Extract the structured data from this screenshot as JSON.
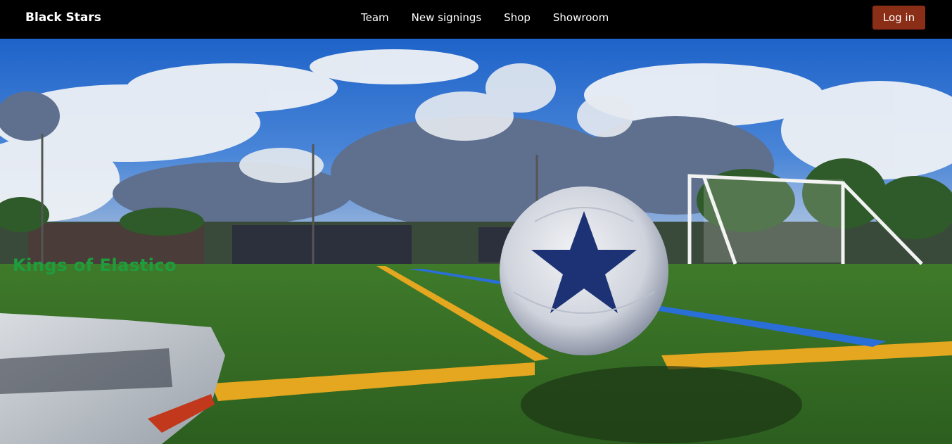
{
  "navbar": {
    "brand": "Black Stars",
    "links": [
      {
        "label": "Team"
      },
      {
        "label": "New signings"
      },
      {
        "label": "Shop"
      },
      {
        "label": "Showroom"
      }
    ],
    "login_label": "Log in"
  },
  "hero": {
    "title": "Kings of Elastico",
    "image_alt": "football-on-pitch-photo"
  },
  "colors": {
    "navbar_bg": "#000000",
    "login_bg": "#8a2e17",
    "title_color": "#1f9d3e"
  }
}
